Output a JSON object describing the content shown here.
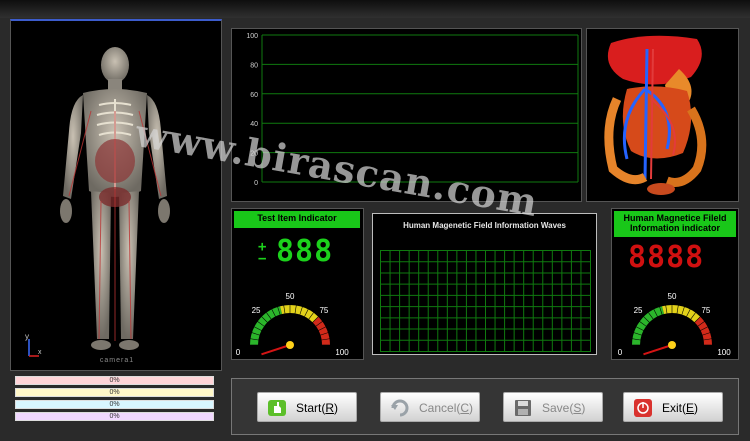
{
  "graph": {
    "y_ticks": [
      "100",
      "80",
      "60",
      "40",
      "20",
      "0"
    ]
  },
  "body_panel": {
    "camera_label": "camera1",
    "axis_y": "y",
    "axis_x": "x"
  },
  "test_item": {
    "title": "Test Item Indicator",
    "plus": "+",
    "minus": "−",
    "display": "888"
  },
  "wave": {
    "title": "Human Magenetic  Field Information Waves"
  },
  "magnetic": {
    "title_line1": "Human Magnetice Fileld",
    "title_line2": "Information indicator",
    "display": "8888"
  },
  "gauge": {
    "ticks": [
      "0",
      "25",
      "50",
      "75",
      "100"
    ]
  },
  "progress": [
    {
      "label": "0%",
      "color": "#ffd4d8"
    },
    {
      "label": "0%",
      "color": "#fff7c8"
    },
    {
      "label": "0%",
      "color": "#d8f6ff"
    },
    {
      "label": "0%",
      "color": "#f1d8ff"
    }
  ],
  "buttons": {
    "start": {
      "text": "Start(",
      "key": "R",
      "tail": ")"
    },
    "cancel": {
      "text": "Cancel(",
      "key": "C",
      "tail": ")"
    },
    "save": {
      "text": "Save(",
      "key": "S",
      "tail": ")"
    },
    "exit": {
      "text": "Exit(",
      "key": "E",
      "tail": ")"
    }
  },
  "watermark": "www.birascan.com",
  "colors": {
    "accent_green": "#19c719",
    "led_green": "#1cd21c",
    "led_red": "#d01010",
    "grid": "#0f7a0f"
  }
}
